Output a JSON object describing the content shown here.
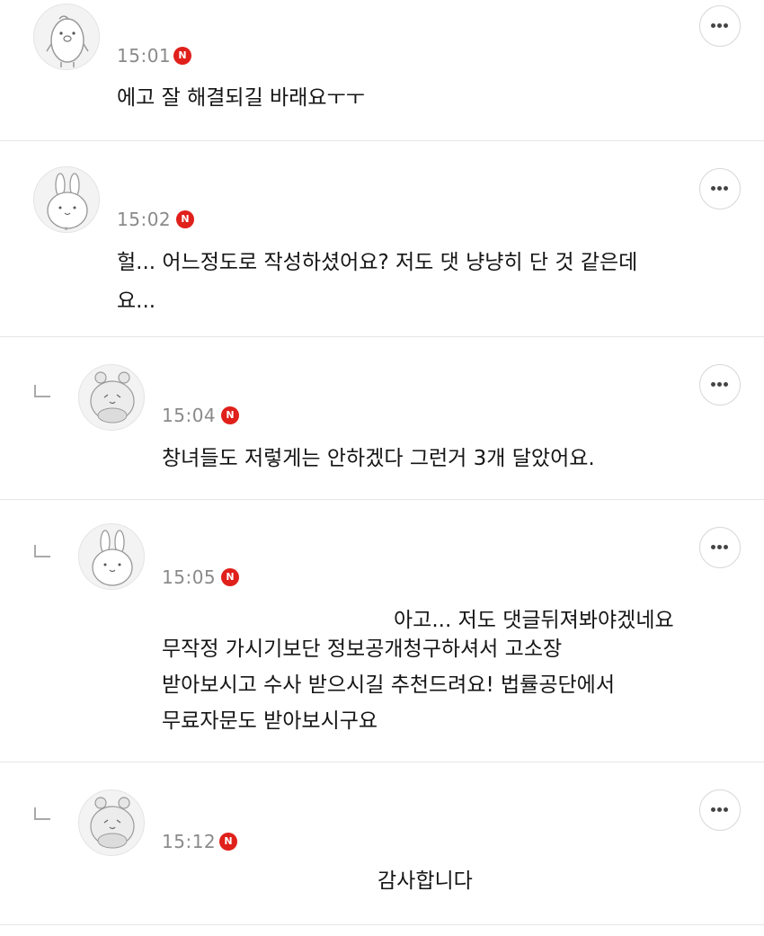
{
  "badge_letter": "N",
  "comments": [
    {
      "time": "15:01",
      "lines": [
        "에고 잘 해결되길 바래요ㅜㅜ"
      ],
      "avatar_icon": "penguin-avatar-icon",
      "is_reply": false
    },
    {
      "time": "15:02",
      "lines": [
        "헐... 어느정도로 작성하셨어요? 저도 댓 냥냥히 단 것 같은데",
        "요..."
      ],
      "avatar_icon": "rabbit-avatar-icon",
      "is_reply": false
    },
    {
      "time": "15:04",
      "lines": [
        "창녀들도 저렇게는 안하겠다 그런거 3개 달았어요."
      ],
      "avatar_icon": "bear-avatar-icon",
      "is_reply": true
    },
    {
      "time": "15:05",
      "lines": [
        "아고... 저도 댓글뒤져봐야겠네요",
        "무작정 가시기보단 정보공개청구하셔서 고소장",
        "받아보시고 수사 받으시길 추천드려요! 법률공단에서",
        "무료자문도 받아보시구요"
      ],
      "avatar_icon": "rabbit-avatar-icon",
      "is_reply": true
    },
    {
      "time": "15:12",
      "lines": [
        "감사합니다"
      ],
      "avatar_icon": "bear-avatar-icon",
      "is_reply": true
    }
  ],
  "colors": {
    "badge": "#e0201b",
    "time": "#8a8a8a",
    "divider": "#e6e6e6"
  }
}
